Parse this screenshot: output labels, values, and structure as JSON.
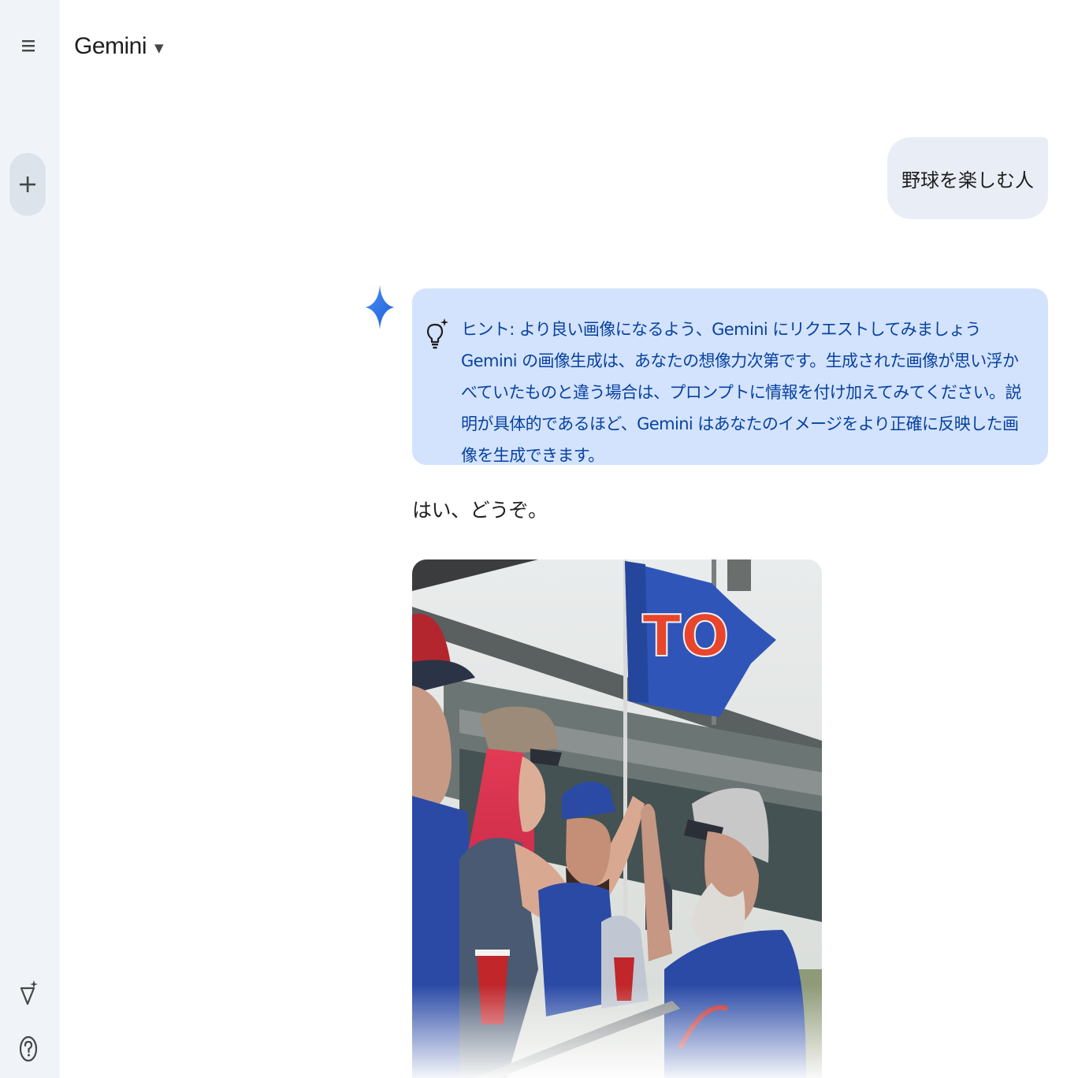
{
  "app": {
    "title": "Gemini",
    "title_caret": "▼"
  },
  "sidebar": {
    "menu_icon": "menu-icon",
    "new_chat_icon": "plus-icon",
    "gem_icon": "gem-sparkle-icon",
    "help_icon": "help-icon"
  },
  "conversation": {
    "user_message": "野球を楽しむ人",
    "hint": {
      "icon": "lightbulb-sparkle-icon",
      "title": "ヒント: より良い画像になるよう、Gemini にリクエストしてみましょう",
      "body": "Gemini の画像生成は、あなたの想像力次第です。生成された画像が思い浮かべていたものと違う場合は、プロンプトに情報を付け加えてみてください。説明が具体的であるほど、Gemini はあなたのイメージをより正確に反映した画像を生成できます。"
    },
    "reply": "はい、どうぞ。",
    "generated_image": {
      "flag_text": "TO",
      "colors": {
        "flag_blue": "#2f55b8",
        "flag_letters": "#e8452c",
        "jersey_blue": "#2a4aa6",
        "hair_red": "#d8324a",
        "cup_red": "#c0262a"
      }
    }
  },
  "colors": {
    "sidebar_bg": "#f0f4f9",
    "user_bubble_bg": "#e9eef6",
    "hint_bg": "#d3e3fd",
    "hint_text": "#0842a0"
  }
}
